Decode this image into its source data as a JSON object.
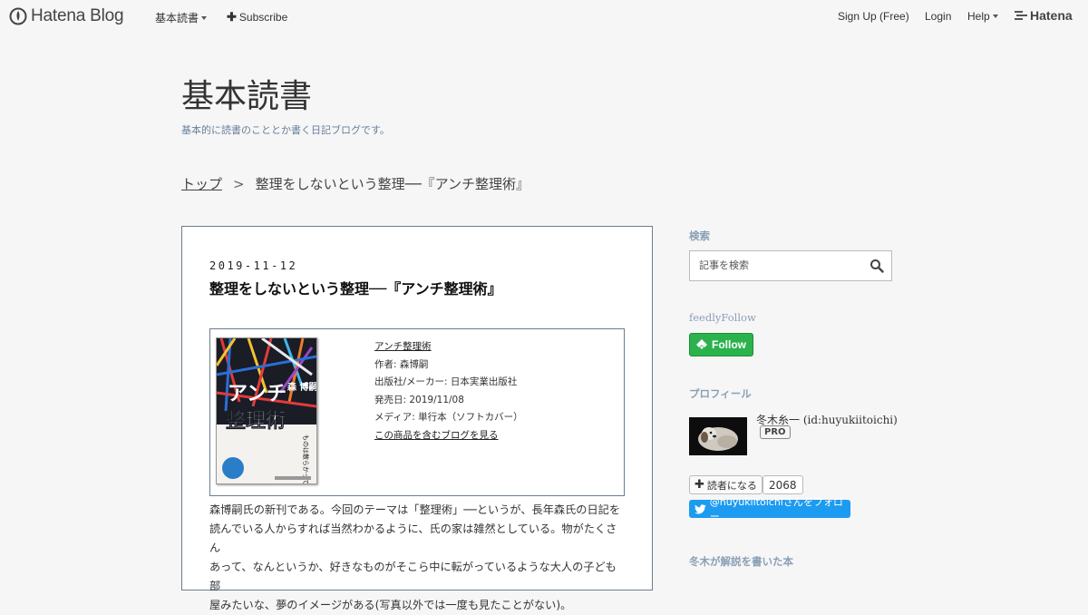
{
  "globalheader": {
    "logo_text": "Hatena Blog",
    "menu_label": "基本読書",
    "subscribe_label": "Subscribe",
    "signup_label": "Sign Up (Free)",
    "login_label": "Login",
    "help_label": "Help",
    "brand_label": "Hatena"
  },
  "blog": {
    "title": "基本読書",
    "description": "基本的に読書のこととか書く日記ブログです。"
  },
  "breadcrumb": {
    "top": "トップ",
    "separator": ">",
    "current": "整理をしないという整理──『アンチ整理術』"
  },
  "entry": {
    "date": "2019-11-12",
    "title": "整理をしないという整理──『アンチ整理術』",
    "product": {
      "title": "アンチ整理術",
      "author": "作者: 森博嗣",
      "publisher": "出版社/メーカー: 日本実業出版社",
      "release": "発売日: 2019/11/08",
      "media": "メディア: 単行本（ソフトカバー）",
      "blog_link": "この商品を含むブログを見る",
      "cover": {
        "author": "森 博嗣",
        "title_line1": "アンチ",
        "title_line2": "整理術",
        "tagline": "ものは散らかっているが、生き方は散らかっていない"
      }
    },
    "body": [
      "森博嗣氏の新刊である。今回のテーマは「整理術」──というが、長年森氏の日記を",
      "読んでいる人からすれば当然わかるように、氏の家は雑然としている。物がたくさん",
      "あって、なんというか、好きなものがそこら中に転がっているような大人の子ども部",
      "屋みたいな、夢のイメージがある(写真以外では一度も見たことがない)。"
    ]
  },
  "sidebar": {
    "search_heading": "検索",
    "search_placeholder": "記事を検索",
    "feedly_heading": "feedlyFollow",
    "feedly_label": "Follow",
    "profile_heading": "プロフィール",
    "profile_name": "冬木糸一 (id:huyukiitoichi)",
    "pro_label": "PRO",
    "reader_label": "読者になる",
    "reader_count": "2068",
    "twitter_label": "@huyukiitoichiさんをフォロー",
    "books_heading": "冬木が解説を書いた本"
  },
  "colors": {
    "background": "#f6f6f6",
    "border": "#6a7d91",
    "sidebar_heading": "#8aa0b6",
    "feedly_green": "#2bb24c",
    "twitter_blue": "#1d9bf0"
  }
}
